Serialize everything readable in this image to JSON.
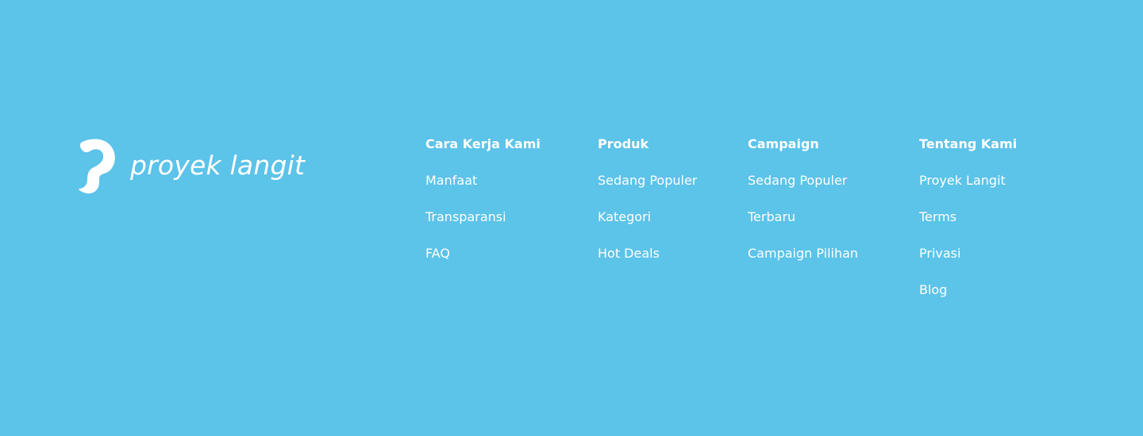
{
  "theme": {
    "background": "#5cc3e9",
    "text": "#ffffff"
  },
  "brand": {
    "name": "proyek langit",
    "icon": "proyek-langit-logo-icon"
  },
  "columns": [
    {
      "title": "Cara Kerja Kami",
      "links": [
        "Manfaat",
        "Transparansi",
        "FAQ"
      ]
    },
    {
      "title": "Produk",
      "links": [
        "Sedang Populer",
        "Kategori",
        "Hot Deals"
      ]
    },
    {
      "title": "Campaign",
      "links": [
        "Sedang Populer",
        "Terbaru",
        "Campaign Pilihan"
      ]
    },
    {
      "title": "Tentang Kami",
      "links": [
        "Proyek Langit",
        "Terms",
        "Privasi",
        "Blog"
      ]
    }
  ]
}
